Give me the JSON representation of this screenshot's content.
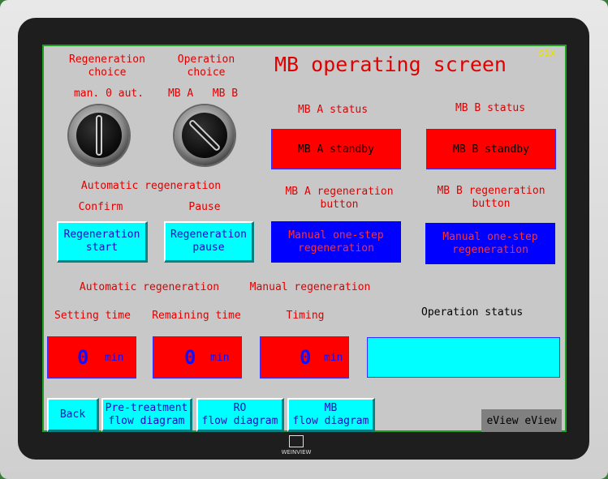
{
  "screen": {
    "title": "MB operating screen",
    "corner_tag": "six",
    "regeneration_choice": {
      "label": "Regeneration\nchoice",
      "positions": "man. 0 aut."
    },
    "operation_choice": {
      "label": "Operation\nchoice",
      "positions": "MB A   MB B"
    },
    "mb_a_status": {
      "label": "MB A status",
      "value": "MB A standby"
    },
    "mb_b_status": {
      "label": "MB B status",
      "value": "MB B standby"
    },
    "auto_regen_header": "Automatic regeneration",
    "confirm_label": "Confirm",
    "pause_label": "Pause",
    "regen_start_button": "Regeneration\nstart",
    "regen_pause_button": "Regeneration\npause",
    "mb_a_regen_label": "MB A regeneration\nbutton",
    "mb_b_regen_label": "MB B regeneration\nbutton",
    "manual_a_button": "Manual one-step\nregeneration",
    "manual_b_button": "Manual one-step\nregeneration",
    "auto_regen_label2": "Automatic regeneration",
    "manual_regen_label": "Manual regeneration",
    "setting_time_label": "Setting time",
    "remaining_time_label": "Remaining time",
    "timing_label": "Timing",
    "operation_status_label": "Operation status",
    "setting_time": {
      "value": "0",
      "unit": "min"
    },
    "remaining_time": {
      "value": "0",
      "unit": "min"
    },
    "timing": {
      "value": "0",
      "unit": "min"
    },
    "operation_status_value": "",
    "nav": {
      "back": "Back",
      "pretreatment": "Pre-treatment\nflow diagram",
      "ro": "RO\nflow diagram",
      "mb": "MB\nflow diagram"
    },
    "eview_badge": "eView eView"
  },
  "bezel": {
    "brand": "WEINVIEW"
  },
  "colors": {
    "alarm_red": "#ff0000",
    "button_cyan": "#00ffff",
    "button_blue": "#0000ff",
    "screen_bg": "#c8c8c8"
  }
}
